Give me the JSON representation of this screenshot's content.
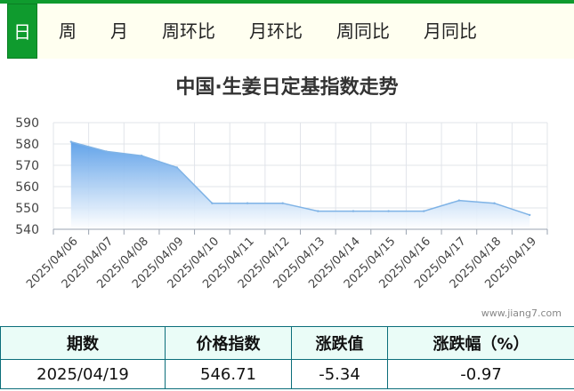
{
  "tabs": [
    {
      "label": "日",
      "active": true
    },
    {
      "label": "周",
      "active": false
    },
    {
      "label": "月",
      "active": false
    },
    {
      "label": "周环比",
      "active": false
    },
    {
      "label": "月环比",
      "active": false
    },
    {
      "label": "周同比",
      "active": false
    },
    {
      "label": "月同比",
      "active": false
    }
  ],
  "watermark": "www.jiang7.com",
  "colors": {
    "accent": "#0f9b2e",
    "line": "#7fb3e6",
    "fill_top": "#6fa8e6",
    "table_border": "#0b6e7a"
  },
  "chart_data": {
    "type": "area",
    "title": "中国·生姜日定基指数走势",
    "x": [
      "2025/04/06",
      "2025/04/07",
      "2025/04/08",
      "2025/04/09",
      "2025/04/10",
      "2025/04/11",
      "2025/04/12",
      "2025/04/13",
      "2025/04/14",
      "2025/04/15",
      "2025/04/16",
      "2025/04/17",
      "2025/04/18",
      "2025/04/19"
    ],
    "values": [
      581,
      576.5,
      574.5,
      569,
      552.2,
      552.2,
      552.2,
      548.5,
      548.5,
      548.5,
      548.5,
      553.5,
      552.2,
      546.71
    ],
    "ylim": [
      540,
      590
    ],
    "yticks": [
      540,
      550,
      560,
      570,
      580,
      590
    ],
    "grid": true
  },
  "table": {
    "headers": [
      "期数",
      "价格指数",
      "涨跌值",
      "涨跌幅（%）"
    ],
    "rows": [
      [
        "2025/04/19",
        "546.71",
        "-5.34",
        "-0.97"
      ]
    ]
  }
}
